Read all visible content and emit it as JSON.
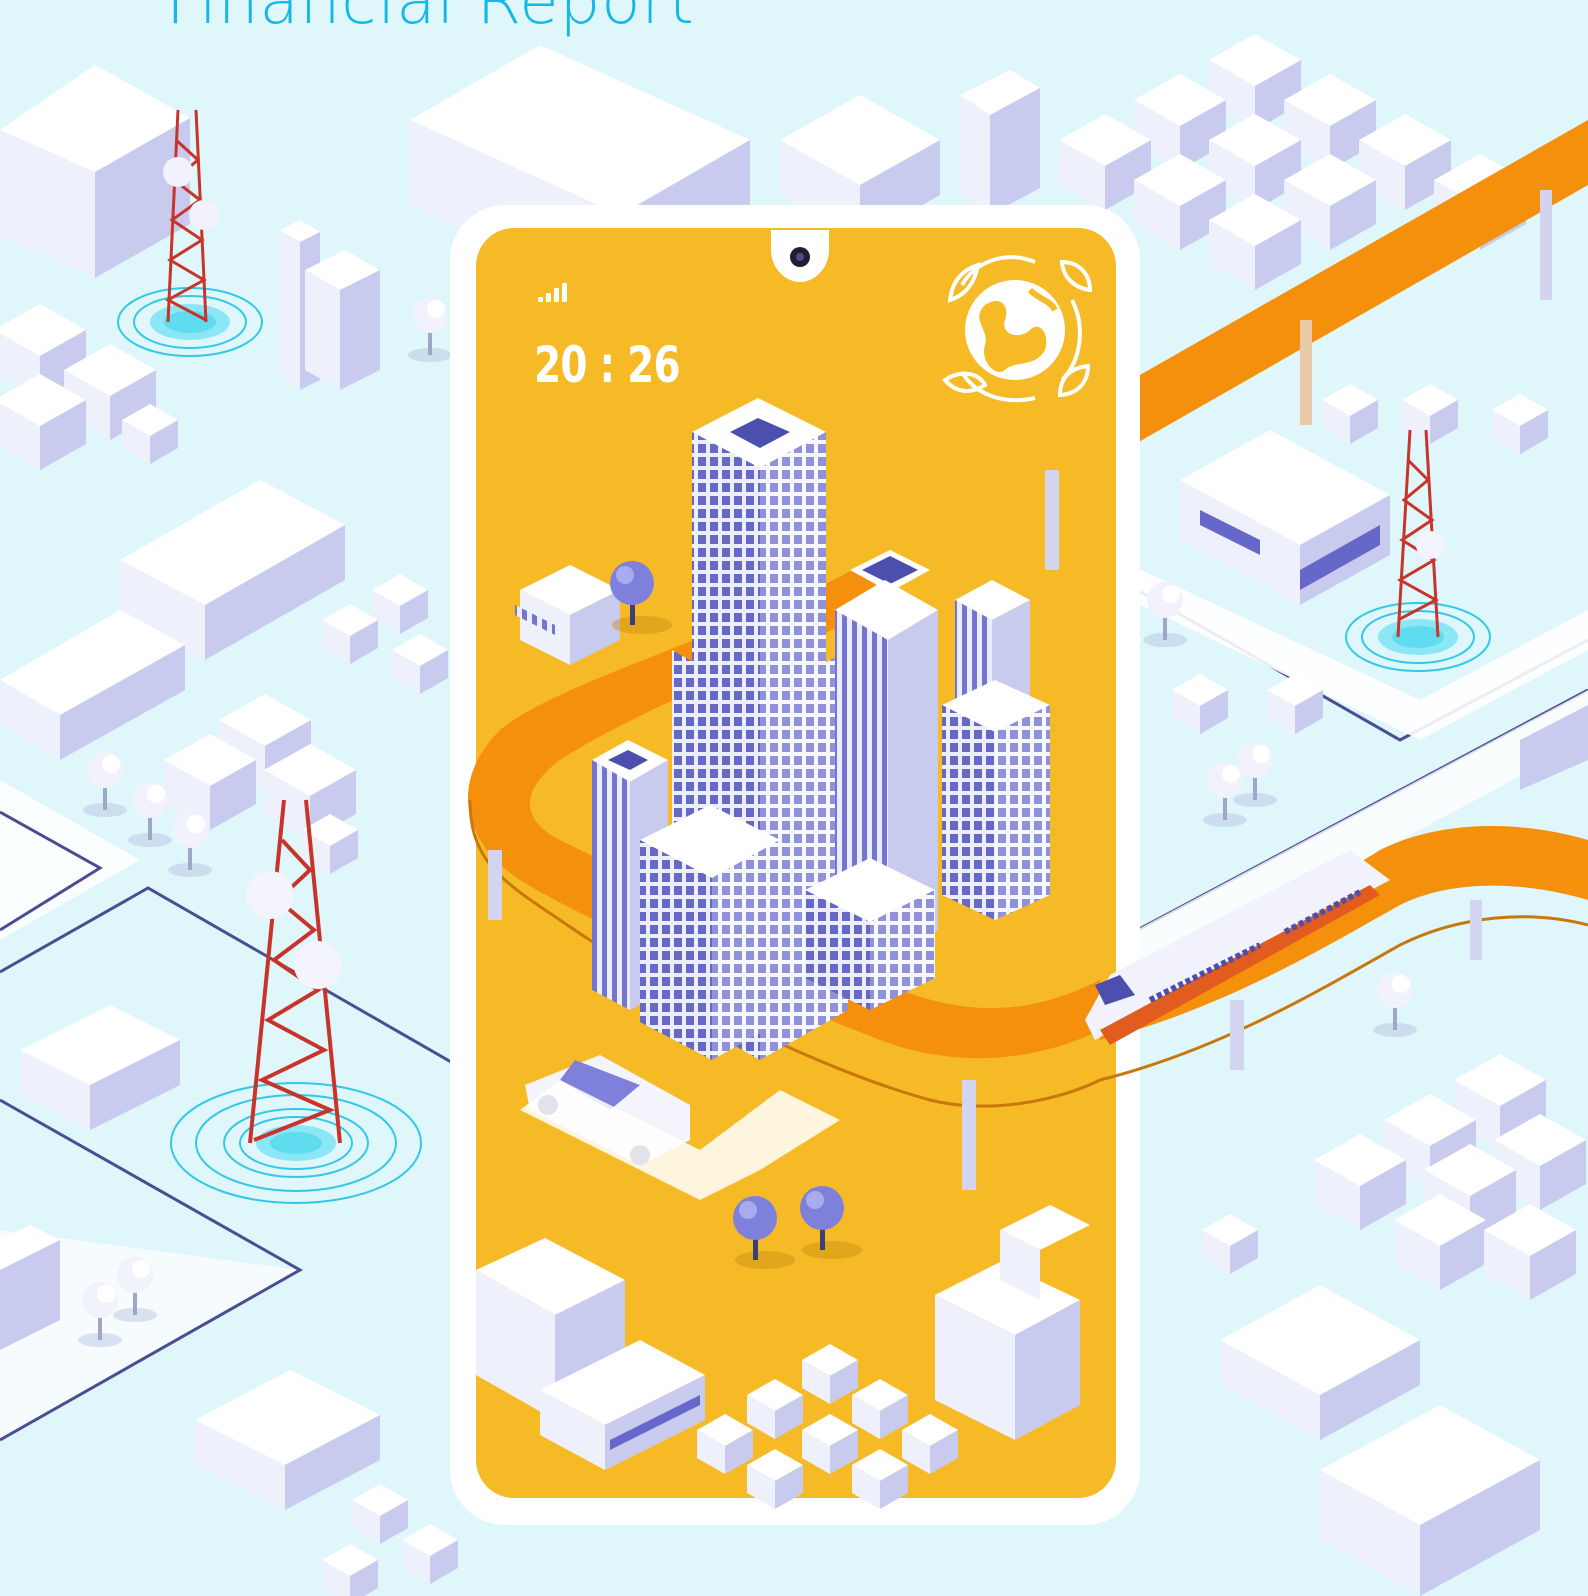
{
  "page": {
    "title": "Financial Report",
    "background_color": "#dff6fb",
    "accent_color": "#12b8e8"
  },
  "phone": {
    "time": "20 : 26",
    "screen_color": "#f5ba26",
    "signal_icon": "signal-bars-icon",
    "globe_icon": "globe-leaves-icon",
    "camera_icon": "front-camera-icon"
  },
  "illustration": {
    "track_color": "#f4900c",
    "tower_color": "#c9342a",
    "building_color": "#8f8fd9"
  }
}
